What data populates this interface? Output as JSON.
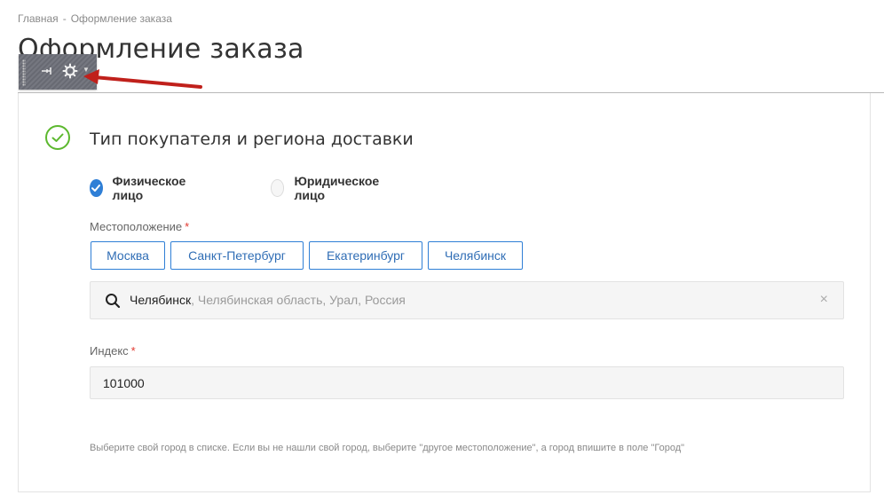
{
  "breadcrumb": {
    "items": [
      "Главная",
      "Оформление заказа"
    ],
    "separator": "-"
  },
  "page_title": "Оформление заказа",
  "admin_toolbar": {
    "icons": [
      "grip-icon",
      "pin-icon",
      "gear-icon",
      "caret-down-icon"
    ]
  },
  "annotation": {
    "arrow_color": "#c0201b"
  },
  "section": {
    "title": "Тип покупателя и региона доставки",
    "status_icon": "check-circle-icon",
    "status_color": "#5cb82e"
  },
  "buyer_type": {
    "options": [
      {
        "label": "Физическое лицо",
        "checked": true
      },
      {
        "label": "Юридическое лицо",
        "checked": false
      }
    ]
  },
  "location": {
    "label": "Местоположение",
    "required_mark": "*",
    "quick_cities": [
      "Москва",
      "Санкт-Петербург",
      "Екатеринбург",
      "Челябинск"
    ],
    "selected_city": "Челябинск",
    "selected_details": ", Челябинская область, Урал, Россия",
    "clear_symbol": "×"
  },
  "index": {
    "label": "Индекс",
    "required_mark": "*",
    "value": "101000"
  },
  "hint": "Выберите свой город в списке. Если вы не нашли свой город, выберите \"другое местоположение\", а город впишите в поле \"Город\"",
  "colors": {
    "accent": "#2f7fd6",
    "required": "#e2382f",
    "success": "#5cb82e"
  }
}
